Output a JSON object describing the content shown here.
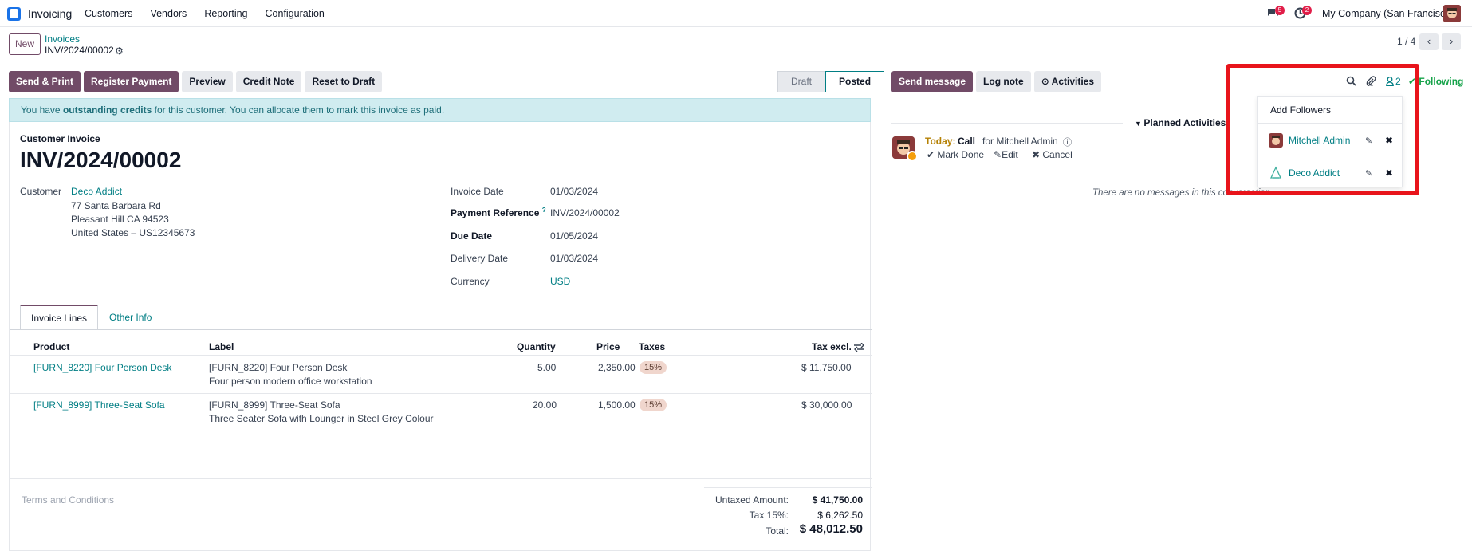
{
  "topbar": {
    "app_name": "Invoicing",
    "nav": [
      "Customers",
      "Vendors",
      "Reporting",
      "Configuration"
    ],
    "messages_count": "5",
    "activities_count": "2",
    "company": "My Company (San Francisco)"
  },
  "control": {
    "new_label": "New",
    "breadcrumb_parent": "Invoices",
    "breadcrumb_current": "INV/2024/00002",
    "pager": "1 / 4"
  },
  "actions": [
    "Send & Print",
    "Register Payment",
    "Preview",
    "Credit Note",
    "Reset to Draft"
  ],
  "status": [
    "Draft",
    "Posted"
  ],
  "alert": {
    "pre": "You have ",
    "strong": "outstanding credits",
    "post": " for this customer. You can allocate them to mark this invoice as paid."
  },
  "invoice": {
    "type_label": "Customer Invoice",
    "number": "INV/2024/00002",
    "customer_label": "Customer",
    "customer_name": "Deco Addict",
    "address": [
      "77 Santa Barbara Rd",
      "Pleasant Hill CA 94523",
      "United States – US12345673"
    ],
    "fields": [
      {
        "label": "Invoice Date",
        "value": "01/03/2024"
      },
      {
        "label": "Payment Reference",
        "value": "INV/2024/00002"
      },
      {
        "label": "Due Date",
        "value": "01/05/2024"
      },
      {
        "label": "Delivery Date",
        "value": "01/03/2024"
      },
      {
        "label": "Currency",
        "value": "USD"
      }
    ],
    "tooltip_mark": "?"
  },
  "tabs": [
    "Invoice Lines",
    "Other Info"
  ],
  "table": {
    "headers": {
      "product": "Product",
      "label": "Label",
      "quantity": "Quantity",
      "price": "Price",
      "taxes": "Taxes",
      "tax_excl": "Tax excl."
    },
    "rows": [
      {
        "product": "[FURN_8220] Four Person Desk",
        "label1": "[FURN_8220] Four Person Desk",
        "label2": "Four person modern office workstation",
        "quantity": "5.00",
        "price": "2,350.00",
        "tax": "15%",
        "subtotal": "$ 11,750.00"
      },
      {
        "product": "[FURN_8999] Three-Seat Sofa",
        "label1": "[FURN_8999] Three-Seat Sofa",
        "label2": "Three Seater Sofa with Lounger in Steel Grey Colour",
        "quantity": "20.00",
        "price": "1,500.00",
        "tax": "15%",
        "subtotal": "$ 30,000.00"
      }
    ]
  },
  "terms_placeholder": "Terms and Conditions",
  "totals": [
    {
      "label": "Untaxed Amount:",
      "value": "$ 41,750.00"
    },
    {
      "label": "Tax 15%:",
      "value": "$ 6,262.50"
    },
    {
      "label": "Total:",
      "value": "$ 48,012.50"
    }
  ],
  "chatter": {
    "buttons": [
      "Send message",
      "Log note",
      "Activities"
    ],
    "followers_count": "2",
    "following_label": "Following",
    "planned_label": "Planned Activities",
    "activity": {
      "today": "Today:",
      "type": "Call",
      "for": "for Mitchell Admin",
      "mark_done": "Mark Done",
      "edit": "Edit",
      "cancel": "Cancel"
    },
    "no_messages": "There are no messages in this conversation."
  },
  "followers_dropdown": {
    "add_label": "Add Followers",
    "followers": [
      "Mitchell Admin",
      "Deco Addict"
    ]
  },
  "colors": {
    "brand": "#714b67",
    "link": "#017e84",
    "highlight": "#e8141b"
  }
}
